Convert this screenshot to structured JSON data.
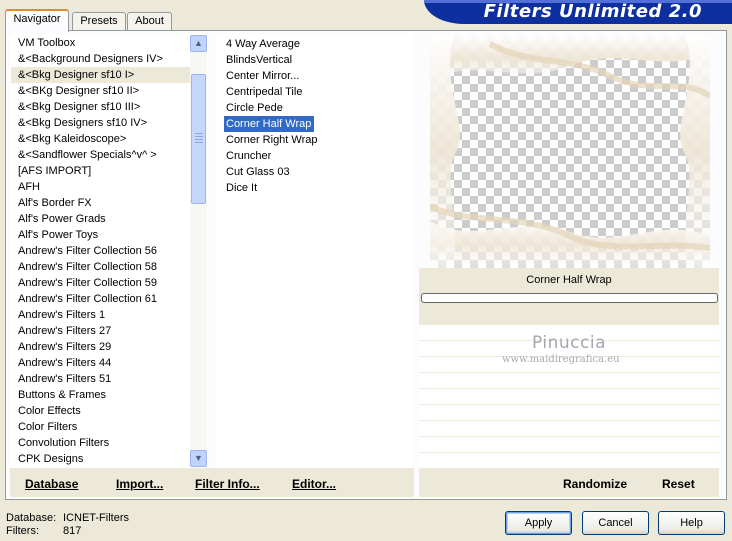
{
  "window": {
    "title": "Filters Unlimited 2.0"
  },
  "tabs": [
    {
      "label": "Navigator",
      "active": true
    },
    {
      "label": "Presets",
      "active": false
    },
    {
      "label": "About",
      "active": false
    }
  ],
  "categories": {
    "items": [
      "VM Toolbox",
      "&<Background Designers IV>",
      "&<Bkg Designer sf10 I>",
      "&<BKg Designer sf10 II>",
      "&<Bkg Designer sf10 III>",
      "&<Bkg Designers sf10 IV>",
      "&<Bkg Kaleidoscope>",
      "&<Sandflower Specials^v^ >",
      "[AFS IMPORT]",
      "AFH",
      "Alf's Border FX",
      "Alf's Power Grads",
      "Alf's Power Toys",
      "Andrew's Filter Collection 56",
      "Andrew's Filter Collection 58",
      "Andrew's Filter Collection 59",
      "Andrew's Filter Collection 61",
      "Andrew's Filters 1",
      "Andrew's Filters 27",
      "Andrew's Filters 29",
      "Andrew's Filters 44",
      "Andrew's Filters 51",
      "Buttons & Frames",
      "Color Effects",
      "Color Filters",
      "Convolution Filters",
      "CPK Designs"
    ],
    "highlighted_index": 2
  },
  "filters": {
    "items": [
      "4 Way Average",
      "BlindsVertical",
      "Center Mirror...",
      "Centripedal Tile",
      "Circle Pede",
      "Corner Half Wrap",
      "Corner Right Wrap",
      "Cruncher",
      "Cut Glass 03",
      "Dice It"
    ],
    "selected_index": 5
  },
  "preview": {
    "filter_name": "Corner Half Wrap",
    "progress": 0
  },
  "watermark": {
    "name": "Pinuccia",
    "site": "www.maidiregrafica.eu"
  },
  "bottom_buttons": {
    "database": "Database",
    "import": "Import...",
    "filter_info": "Filter Info...",
    "editor": "Editor...",
    "randomize": "Randomize",
    "reset": "Reset"
  },
  "status": {
    "database_label": "Database:",
    "database_value": "ICNET-Filters",
    "filters_label": "Filters:",
    "filters_value": "817"
  },
  "dialog_buttons": {
    "apply": "Apply",
    "cancel": "Cancel",
    "help": "Help"
  },
  "colors": {
    "title_bar": "#0d2fa0",
    "selection": "#316ac5",
    "highlight": "#ece9d8"
  }
}
